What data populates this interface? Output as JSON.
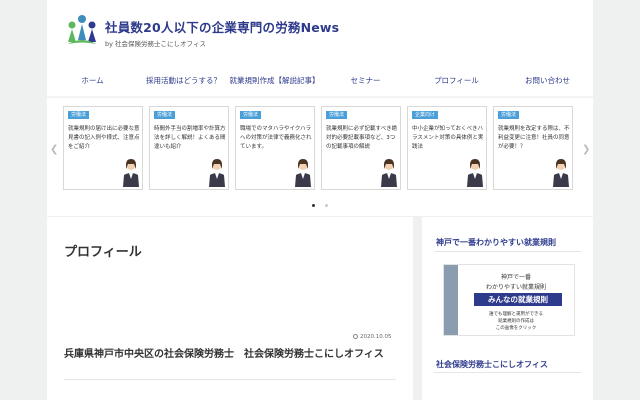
{
  "header": {
    "title": "社員数20人以下の企業専門の労務News",
    "subtitle": "by 社会保険労務士こにしオフィス",
    "nav": [
      "ホーム",
      "採用活動はどうする？",
      "就業規則作成【解説記事】",
      "セミナー",
      "プロフィール",
      "お問い合わせ"
    ]
  },
  "carousel": {
    "cards": [
      {
        "category": "労働法",
        "text": "就業規則の届け出に必要な意見書の記入例や様式、注意点をご紹介"
      },
      {
        "category": "労働法",
        "text": "時間外手当の割増率や計算方法を詳しく解説！よくある間違いも紹介"
      },
      {
        "category": "労働法",
        "text": "職場でのマタハラやイクハラへの対策が法律で義務化されています。"
      },
      {
        "category": "労働法",
        "text": "就業規則に必ず記載すべき絶対的必要記載事項など、3つの記載事項の解説"
      },
      {
        "category": "企業向け",
        "text": "中小企業が知っておくべきハラスメント対策の具体例と実践法"
      },
      {
        "category": "労働法",
        "text": "就業規則を改定する際は、不利益変更に注意！社員の同意が必要！？"
      }
    ]
  },
  "main": {
    "page_title": "プロフィール",
    "date": "2020.10.05",
    "post_title": "兵庫県神戸市中央区の社会保険労務士　社会保険労務士こにしオフィス"
  },
  "sidebar": {
    "widget1_title": "神戸で一番わかりやすい就業規則",
    "banner": {
      "line1": "神戸で一番",
      "line2": "わかりやすい就業規則",
      "main": "みんなの就業規則",
      "sub1": "誰でも理解と運用ができる",
      "sub2": "就業規則の作成は",
      "sub3": "この画像をクリック"
    },
    "widget2_title": "社会保険労務士こにしオフィス"
  },
  "colors": {
    "brand": "#2e3a8c",
    "badge": "#4a9fd8",
    "background": "#eef1f0"
  }
}
